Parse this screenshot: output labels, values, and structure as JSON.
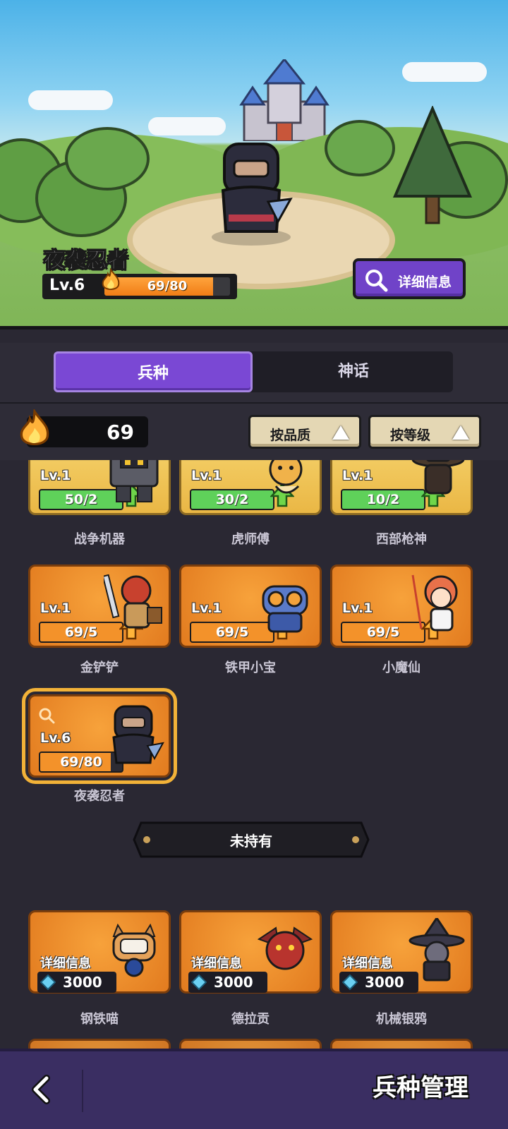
{
  "hero": {
    "name": "夜袭忍者",
    "level_label": "Lv.6",
    "progress_text": "69/80",
    "progress_fraction": 0.8625,
    "detail_button": "详细信息"
  },
  "tabs": [
    {
      "label": "兵种",
      "active": true
    },
    {
      "label": "神话",
      "active": false
    }
  ],
  "resource": {
    "value": "69",
    "icon": "flame-icon"
  },
  "sort_buttons": [
    {
      "label": "按品质",
      "icon": "triangle-up-icon"
    },
    {
      "label": "按等级",
      "icon": "triangle-up-icon"
    }
  ],
  "owned_units": [
    {
      "name": "战争机器",
      "level": "Lv.1",
      "progress": "50/2",
      "progress_fraction": 1.0,
      "style": "gold",
      "bar_color": "#5fd15a",
      "upgradable": true
    },
    {
      "name": "虎师傅",
      "level": "Lv.1",
      "progress": "30/2",
      "progress_fraction": 1.0,
      "style": "gold",
      "bar_color": "#5fd15a",
      "upgradable": true
    },
    {
      "name": "西部枪神",
      "level": "Lv.1",
      "progress": "10/2",
      "progress_fraction": 1.0,
      "style": "gold",
      "bar_color": "#5fd15a",
      "upgradable": true
    },
    {
      "name": "金铲铲",
      "level": "Lv.1",
      "progress": "69/5",
      "progress_fraction": 1.0,
      "style": "orange",
      "bar_color": "#f3922a",
      "upgradable": true
    },
    {
      "name": "铁甲小宝",
      "level": "Lv.1",
      "progress": "69/5",
      "progress_fraction": 1.0,
      "style": "orange",
      "bar_color": "#f3922a",
      "upgradable": true
    },
    {
      "name": "小魔仙",
      "level": "Lv.1",
      "progress": "69/5",
      "progress_fraction": 1.0,
      "style": "orange",
      "bar_color": "#f3922a",
      "upgradable": true
    },
    {
      "name": "夜袭忍者",
      "level": "Lv.6",
      "progress": "69/80",
      "progress_fraction": 0.8625,
      "style": "orange",
      "bar_color": "#f3922a",
      "upgradable": false,
      "selected": true
    }
  ],
  "divider_label": "未持有",
  "unowned_units": [
    {
      "name": "钢铁喵",
      "info_label": "详细信息",
      "price": "3000"
    },
    {
      "name": "德拉贡",
      "info_label": "详细信息",
      "price": "3000"
    },
    {
      "name": "机械银鸦",
      "info_label": "详细信息",
      "price": "3000"
    }
  ],
  "bottom_bar": {
    "title": "兵种管理",
    "back_icon": "back-arrow-icon"
  },
  "colors": {
    "accent_purple": "#7a48d4",
    "gold_card": "#eab745",
    "orange_card": "#e27b1f",
    "green_bar": "#5fd15a",
    "orange_bar": "#f3922a"
  }
}
